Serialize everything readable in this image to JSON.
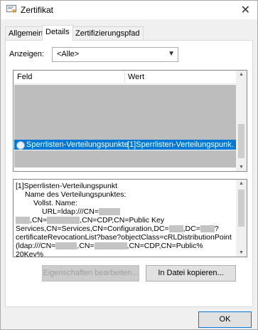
{
  "window": {
    "title": "Zertifikat",
    "close_glyph": "✕"
  },
  "tabs": [
    {
      "label": "Allgemein",
      "active": false
    },
    {
      "label": "Details",
      "active": true
    },
    {
      "label": "Zertifizierungspfad",
      "active": false
    }
  ],
  "show": {
    "label": "Anzeigen:",
    "value": "<Alle>"
  },
  "list": {
    "col_field": "Feld",
    "col_value": "Wert",
    "selected_row": {
      "field": "Sperrlisten-Verteilungspunkte",
      "value": "[1]Sperrlisten-Verteilungspunk..."
    }
  },
  "details": {
    "line1": "[1]Sperrlisten-Verteilungspunkt",
    "line2": "Name des Verteilungspunktes:",
    "line3": "Vollst. Name:",
    "line4": "URL=ldap:///CN=",
    "line5": ",CN=CDP,CN=Public Key",
    "line6": "Services,CN=Services,CN=Configuration,DC=",
    "line6b": ",DC=",
    "line6c": "?",
    "line7": "certificateRevocationList?base?objectClass=cRLDistributionPoint",
    "line8a": "(ldap:///CN=",
    "line8b": ",CN=",
    "line8c": ",CN=CDP,CN=Public%",
    "line9": "20Key%"
  },
  "buttons": {
    "edit": "Eigenschaften bearbeiten...",
    "copy": "In Datei kopieren...",
    "ok": "OK"
  },
  "colors": {
    "selection": "#0078d7",
    "window_bg": "#f0f0f0"
  }
}
